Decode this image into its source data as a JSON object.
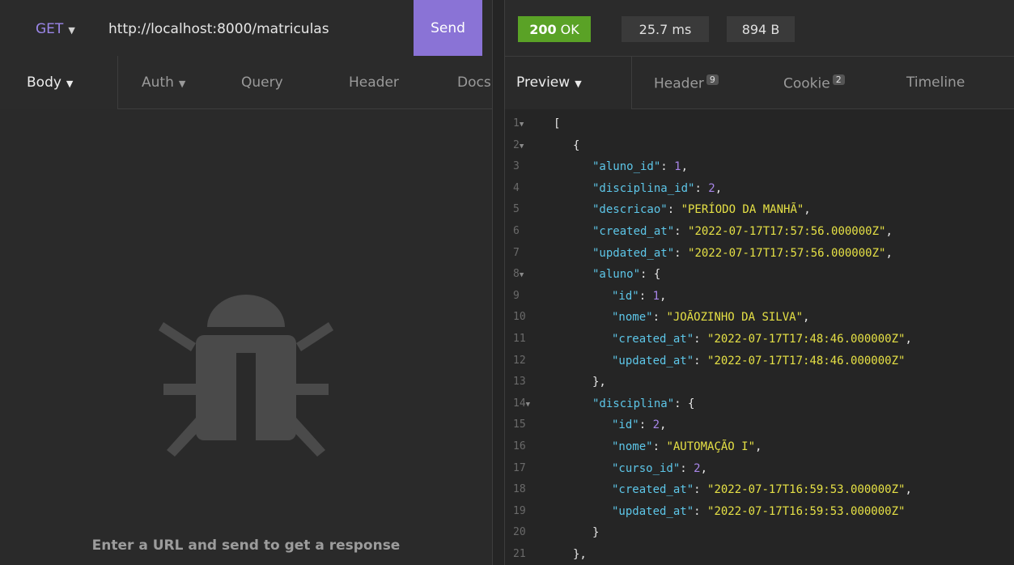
{
  "request": {
    "method": "GET",
    "url": "http://localhost:8000/matriculas",
    "send_label": "Send"
  },
  "response_status": {
    "code": "200",
    "text": "OK",
    "time": "25.7 ms",
    "size": "894 B"
  },
  "request_tabs": [
    "Body",
    "Auth",
    "Query",
    "Header",
    "Docs"
  ],
  "response_tabs": [
    {
      "label": "Preview",
      "badge": ""
    },
    {
      "label": "Header",
      "badge": "9"
    },
    {
      "label": "Cookie",
      "badge": "2"
    },
    {
      "label": "Timeline",
      "badge": ""
    }
  ],
  "empty_state": {
    "message": "Enter a URL and send to get a response",
    "icon": "bug-icon"
  },
  "colors": {
    "accent": "#8a73d6",
    "status_ok": "#5aa226",
    "json_key": "#5dc6e8",
    "json_string": "#e5e045",
    "json_number": "#a886e8"
  },
  "code_lines": [
    {
      "n": "1",
      "fold": true,
      "indent": 0,
      "parts": [
        {
          "t": "p",
          "v": "["
        }
      ]
    },
    {
      "n": "2",
      "fold": true,
      "indent": 1,
      "parts": [
        {
          "t": "p",
          "v": "{"
        }
      ]
    },
    {
      "n": "3",
      "fold": false,
      "indent": 2,
      "parts": [
        {
          "t": "k",
          "v": "\"aluno_id\""
        },
        {
          "t": "p",
          "v": ": "
        },
        {
          "t": "n",
          "v": "1"
        },
        {
          "t": "p",
          "v": ","
        }
      ]
    },
    {
      "n": "4",
      "fold": false,
      "indent": 2,
      "parts": [
        {
          "t": "k",
          "v": "\"disciplina_id\""
        },
        {
          "t": "p",
          "v": ": "
        },
        {
          "t": "n",
          "v": "2"
        },
        {
          "t": "p",
          "v": ","
        }
      ]
    },
    {
      "n": "5",
      "fold": false,
      "indent": 2,
      "parts": [
        {
          "t": "k",
          "v": "\"descricao\""
        },
        {
          "t": "p",
          "v": ": "
        },
        {
          "t": "s",
          "v": "\"PERÍODO DA MANHÃ\""
        },
        {
          "t": "p",
          "v": ","
        }
      ]
    },
    {
      "n": "6",
      "fold": false,
      "indent": 2,
      "parts": [
        {
          "t": "k",
          "v": "\"created_at\""
        },
        {
          "t": "p",
          "v": ": "
        },
        {
          "t": "s",
          "v": "\"2022-07-17T17:57:56.000000Z\""
        },
        {
          "t": "p",
          "v": ","
        }
      ]
    },
    {
      "n": "7",
      "fold": false,
      "indent": 2,
      "parts": [
        {
          "t": "k",
          "v": "\"updated_at\""
        },
        {
          "t": "p",
          "v": ": "
        },
        {
          "t": "s",
          "v": "\"2022-07-17T17:57:56.000000Z\""
        },
        {
          "t": "p",
          "v": ","
        }
      ]
    },
    {
      "n": "8",
      "fold": true,
      "indent": 2,
      "parts": [
        {
          "t": "k",
          "v": "\"aluno\""
        },
        {
          "t": "p",
          "v": ": {"
        }
      ]
    },
    {
      "n": "9",
      "fold": false,
      "indent": 3,
      "parts": [
        {
          "t": "k",
          "v": "\"id\""
        },
        {
          "t": "p",
          "v": ": "
        },
        {
          "t": "n",
          "v": "1"
        },
        {
          "t": "p",
          "v": ","
        }
      ]
    },
    {
      "n": "10",
      "fold": false,
      "indent": 3,
      "parts": [
        {
          "t": "k",
          "v": "\"nome\""
        },
        {
          "t": "p",
          "v": ": "
        },
        {
          "t": "s",
          "v": "\"JOÃOZINHO DA SILVA\""
        },
        {
          "t": "p",
          "v": ","
        }
      ]
    },
    {
      "n": "11",
      "fold": false,
      "indent": 3,
      "parts": [
        {
          "t": "k",
          "v": "\"created_at\""
        },
        {
          "t": "p",
          "v": ": "
        },
        {
          "t": "s",
          "v": "\"2022-07-17T17:48:46.000000Z\""
        },
        {
          "t": "p",
          "v": ","
        }
      ]
    },
    {
      "n": "12",
      "fold": false,
      "indent": 3,
      "parts": [
        {
          "t": "k",
          "v": "\"updated_at\""
        },
        {
          "t": "p",
          "v": ": "
        },
        {
          "t": "s",
          "v": "\"2022-07-17T17:48:46.000000Z\""
        }
      ]
    },
    {
      "n": "13",
      "fold": false,
      "indent": 2,
      "parts": [
        {
          "t": "p",
          "v": "},"
        }
      ]
    },
    {
      "n": "14",
      "fold": true,
      "indent": 2,
      "parts": [
        {
          "t": "k",
          "v": "\"disciplina\""
        },
        {
          "t": "p",
          "v": ": {"
        }
      ]
    },
    {
      "n": "15",
      "fold": false,
      "indent": 3,
      "parts": [
        {
          "t": "k",
          "v": "\"id\""
        },
        {
          "t": "p",
          "v": ": "
        },
        {
          "t": "n",
          "v": "2"
        },
        {
          "t": "p",
          "v": ","
        }
      ]
    },
    {
      "n": "16",
      "fold": false,
      "indent": 3,
      "parts": [
        {
          "t": "k",
          "v": "\"nome\""
        },
        {
          "t": "p",
          "v": ": "
        },
        {
          "t": "s",
          "v": "\"AUTOMAÇÃO I\""
        },
        {
          "t": "p",
          "v": ","
        }
      ]
    },
    {
      "n": "17",
      "fold": false,
      "indent": 3,
      "parts": [
        {
          "t": "k",
          "v": "\"curso_id\""
        },
        {
          "t": "p",
          "v": ": "
        },
        {
          "t": "n",
          "v": "2"
        },
        {
          "t": "p",
          "v": ","
        }
      ]
    },
    {
      "n": "18",
      "fold": false,
      "indent": 3,
      "parts": [
        {
          "t": "k",
          "v": "\"created_at\""
        },
        {
          "t": "p",
          "v": ": "
        },
        {
          "t": "s",
          "v": "\"2022-07-17T16:59:53.000000Z\""
        },
        {
          "t": "p",
          "v": ","
        }
      ]
    },
    {
      "n": "19",
      "fold": false,
      "indent": 3,
      "parts": [
        {
          "t": "k",
          "v": "\"updated_at\""
        },
        {
          "t": "p",
          "v": ": "
        },
        {
          "t": "s",
          "v": "\"2022-07-17T16:59:53.000000Z\""
        }
      ]
    },
    {
      "n": "20",
      "fold": false,
      "indent": 2,
      "parts": [
        {
          "t": "p",
          "v": "}"
        }
      ]
    },
    {
      "n": "21",
      "fold": false,
      "indent": 1,
      "parts": [
        {
          "t": "p",
          "v": "},"
        }
      ]
    }
  ]
}
